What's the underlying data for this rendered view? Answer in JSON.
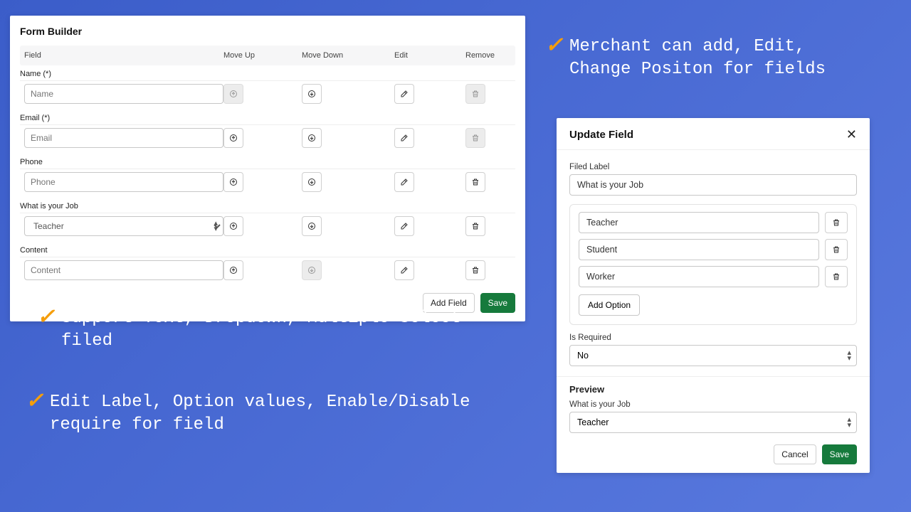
{
  "formBuilder": {
    "title": "Form Builder",
    "columns": {
      "field": "Field",
      "moveUp": "Move Up",
      "moveDown": "Move Down",
      "edit": "Edit",
      "remove": "Remove"
    },
    "rows": [
      {
        "label": "Name (*)",
        "value": "Name",
        "type": "text",
        "upDisabled": true,
        "downDisabled": false,
        "removeDisabled": true
      },
      {
        "label": "Email (*)",
        "value": "Email",
        "type": "text",
        "upDisabled": false,
        "downDisabled": false,
        "removeDisabled": true
      },
      {
        "label": "Phone",
        "value": "Phone",
        "type": "text",
        "upDisabled": false,
        "downDisabled": false,
        "removeDisabled": false
      },
      {
        "label": "What is your Job",
        "value": "Teacher",
        "type": "select",
        "upDisabled": false,
        "downDisabled": false,
        "removeDisabled": false
      },
      {
        "label": "Content",
        "value": "Content",
        "type": "text",
        "upDisabled": false,
        "downDisabled": true,
        "removeDisabled": false
      }
    ],
    "addField": "Add Field",
    "save": "Save"
  },
  "modal": {
    "title": "Update Field",
    "labelLabel": "Filed Label",
    "labelValue": "What is your Job",
    "options": [
      "Teacher",
      "Student",
      "Worker"
    ],
    "addOption": "Add Option",
    "isRequiredLabel": "Is Required",
    "isRequiredValue": "No",
    "previewTitle": "Preview",
    "previewFieldLabel": "What is your Job",
    "previewFieldValue": "Teacher",
    "cancel": "Cancel",
    "save": "Save"
  },
  "bullets": {
    "b1": "Merchant can add, Edit, Change Positon for fields",
    "b2": "Support Text, Dropdown, Multiple Select filed",
    "b3": "Edit Label, Option values, Enable/Disable require for field"
  }
}
